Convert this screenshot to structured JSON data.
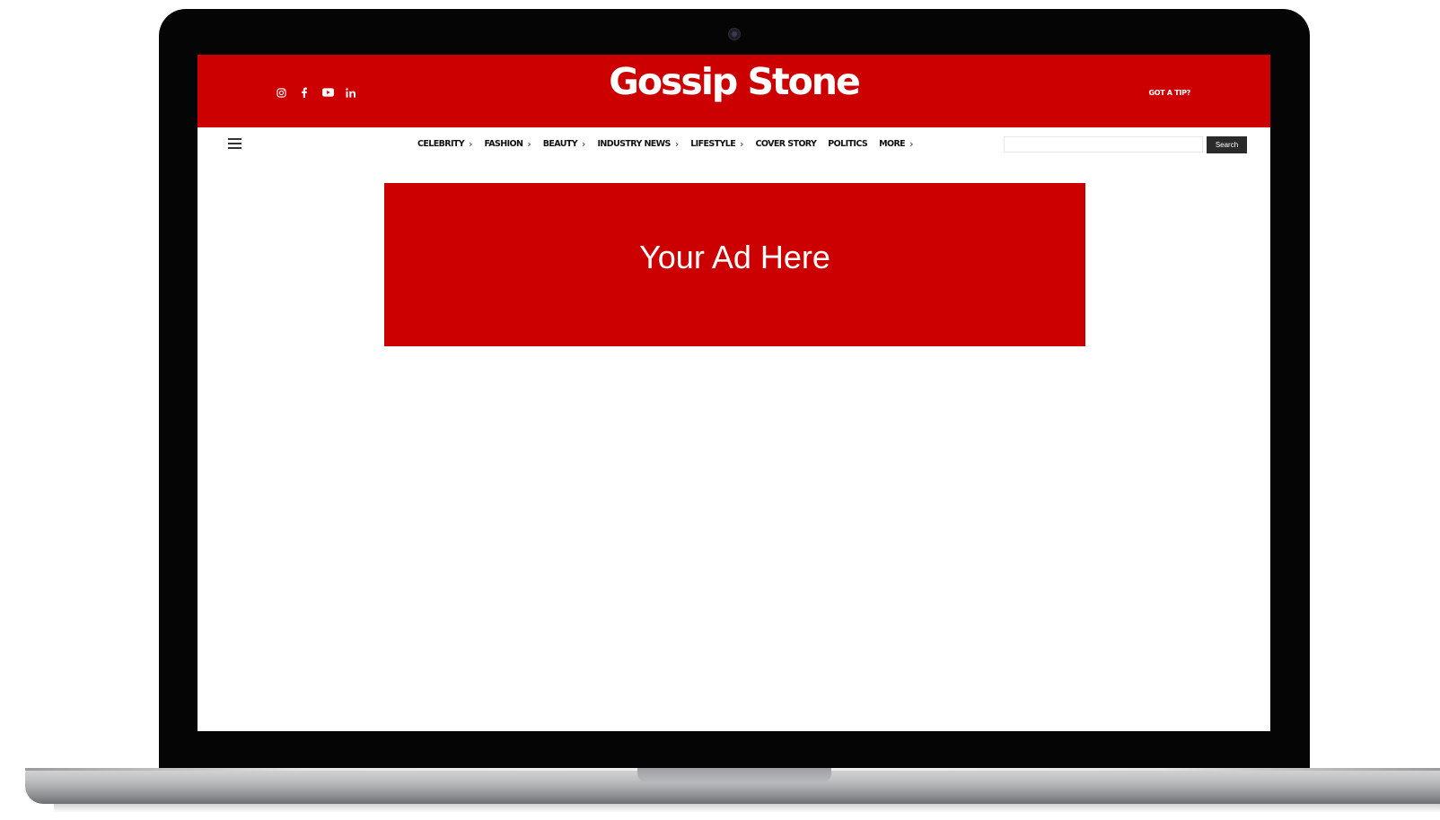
{
  "site": {
    "logo": "Gossip Stone",
    "tip_link": "GOT A TIP?",
    "brand_color": "#cc0000"
  },
  "social": [
    {
      "icon": "instagram-icon"
    },
    {
      "icon": "facebook-icon"
    },
    {
      "icon": "youtube-icon"
    },
    {
      "icon": "linkedin-icon",
      "label": "in"
    }
  ],
  "nav": {
    "menu_icon": "hamburger-icon",
    "items": [
      {
        "label": "CELEBRITY",
        "has_submenu": true
      },
      {
        "label": "FASHION",
        "has_submenu": true
      },
      {
        "label": "BEAUTY",
        "has_submenu": true
      },
      {
        "label": "INDUSTRY NEWS",
        "has_submenu": true
      },
      {
        "label": "LIFESTYLE",
        "has_submenu": true
      },
      {
        "label": "COVER STORY",
        "has_submenu": false
      },
      {
        "label": "POLITICS",
        "has_submenu": false
      },
      {
        "label": "MORE",
        "has_submenu": true
      }
    ],
    "chevron": "›"
  },
  "search": {
    "value": "",
    "placeholder": "",
    "button_label": "Search"
  },
  "ad": {
    "text": "Your Ad Here"
  }
}
